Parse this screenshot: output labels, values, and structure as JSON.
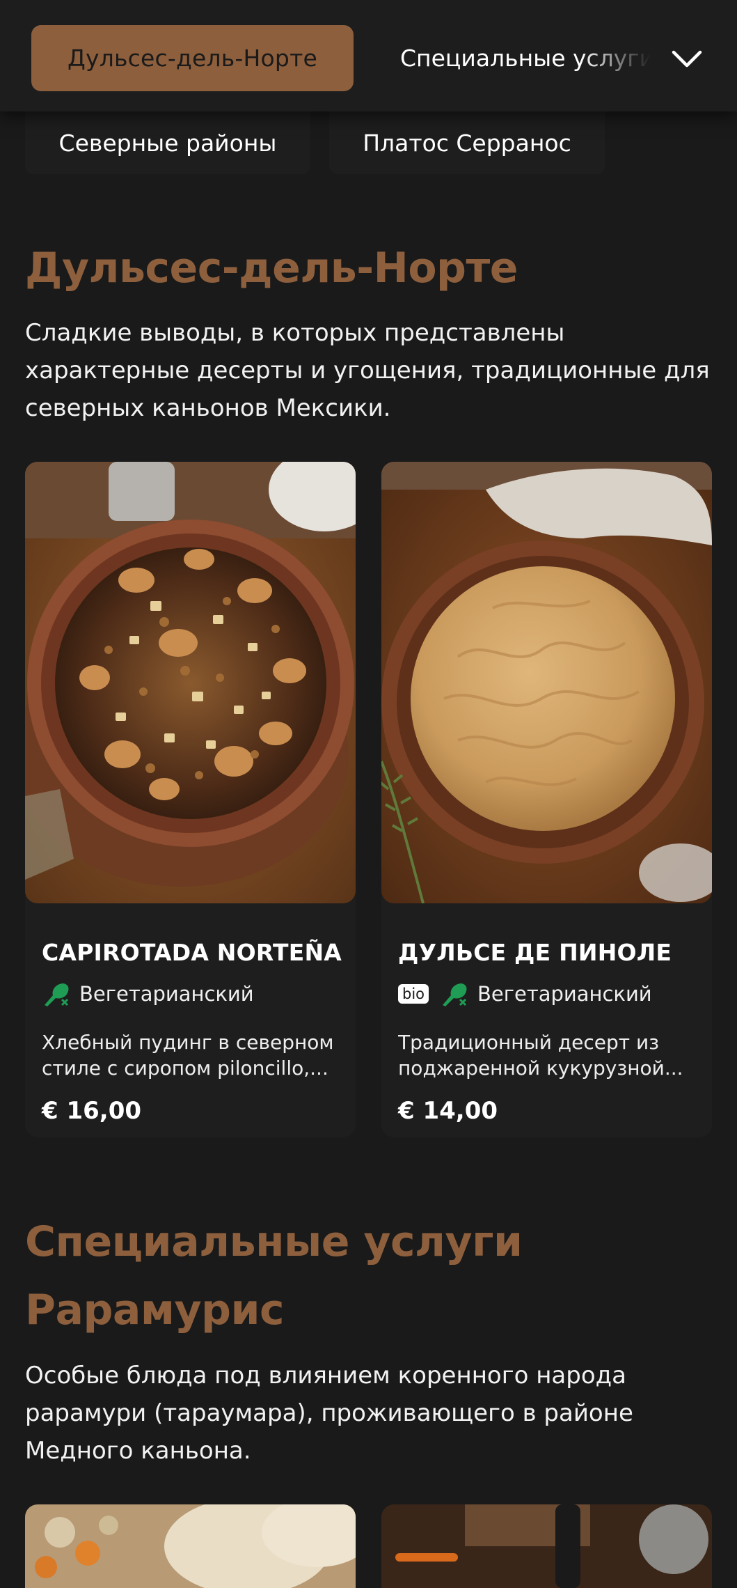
{
  "nav": {
    "active_tab": "Дульсес-дель-Норте",
    "next_tab": "Специальные услуги Рарамурис",
    "tabs": [
      "Северные районы",
      "Платос Серранос"
    ]
  },
  "sections": [
    {
      "title": "Дульсес-дель-Норте",
      "description": "Сладкие выводы, в которых представлены характерные десерты и угощения, традиционные для северных каньонов Мексики."
    },
    {
      "title_line1": "Специальные услуги",
      "title_line2": "Рарамурис",
      "description": "Особые блюда под влиянием коренного народа рарамури (тараумара), проживающего в районе Медного каньона."
    }
  ],
  "products": [
    {
      "name": "CAPIROTADA NORTEÑA",
      "bio": "",
      "diet_label": "Вегетарианский",
      "description_line1": "Хлебный пудинг в северном",
      "description_line2": "стиле с сиропом piloncillo,...",
      "price": "€ 16,00"
    },
    {
      "name": "ДУЛЬСЕ ДЕ ПИНОЛЕ",
      "bio": "bio",
      "diet_label": "Вегетарианский",
      "description_line1": "Традиционный десерт из",
      "description_line2": "поджаренной кукурузной...",
      "price": "€ 14,00"
    }
  ],
  "colors": {
    "accent": "#8d5f3d",
    "background": "#1a1a1a",
    "card": "#1e1e1e",
    "veg_green": "#1f9d55"
  },
  "icons": {
    "menu_toggle": "chevron-down-icon",
    "diet": "vegetarian-icon"
  }
}
